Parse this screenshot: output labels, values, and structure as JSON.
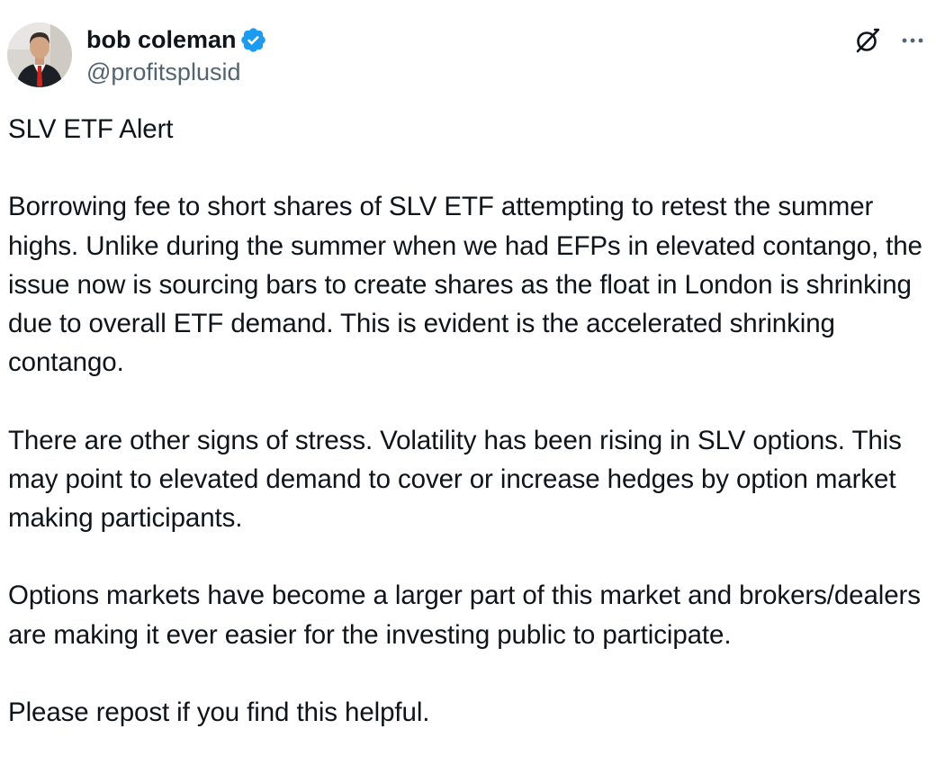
{
  "author": {
    "display_name": "bob coleman",
    "handle": "@profitsplusid",
    "verified": true,
    "verified_color": "#1d9bf0"
  },
  "icons": {
    "verified": "verified-badge-icon",
    "grok": "grok-icon",
    "more": "more-options-icon"
  },
  "tweet": {
    "text": "SLV ETF Alert\n\nBorrowing fee to short shares of SLV ETF attempting to retest the summer highs. Unlike during the summer when we had EFPs in elevated contango, the issue now is sourcing bars to create shares as the float in London is shrinking due to overall ETF demand. This is evident is the accelerated shrinking contango.\n\nThere are other signs of stress. Volatility has been rising in SLV options. This may point to elevated demand to cover or increase hedges by option market making participants.\n\nOptions markets have become a larger part of this market and brokers/dealers are making it ever easier for the investing public to participate.\n\nPlease repost if you find this helpful."
  },
  "colors": {
    "text": "#0f1419",
    "secondary_text": "#536471",
    "background": "#ffffff"
  }
}
